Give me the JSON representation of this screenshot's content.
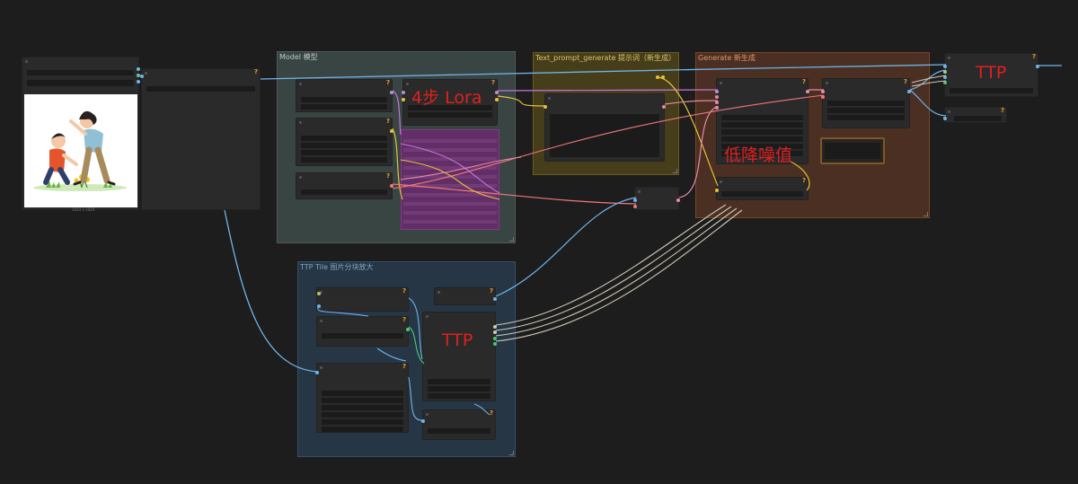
{
  "groups": {
    "model": "Model 模型",
    "text_prompt": "Text_prompt_generate 提示词（新生成）",
    "generate": "Generate 新生成",
    "ttp_tile": "TTP Tile 图片分块放大"
  },
  "annotations": {
    "lora": "4步 Lora",
    "denoise": "低降噪值",
    "ttp_mid": "TTP",
    "ttp_top": "TTP"
  },
  "preview": {
    "caption": "1024 x 1024",
    "alt": "children illustration"
  },
  "colors": {
    "wire_blue": "#6fb4ea",
    "wire_yellow": "#e6c23a",
    "wire_pink": "#e88aa8",
    "wire_purple": "#c674d8",
    "wire_salmon": "#f07878",
    "wire_gray": "#cfc9b6",
    "annotation_red": "#e02020"
  }
}
